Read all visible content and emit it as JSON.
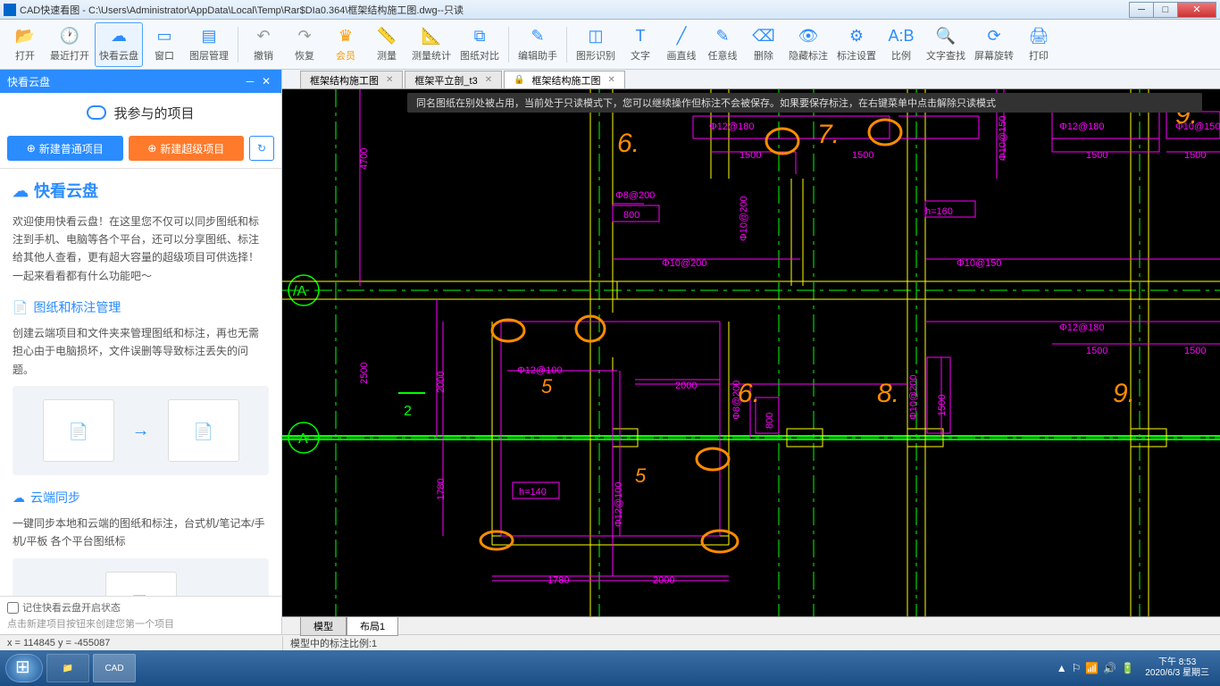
{
  "window": {
    "title": "CAD快速看图 - C:\\Users\\Administrator\\AppData\\Local\\Temp\\Rar$DIa0.364\\框架结构施工图.dwg--只读"
  },
  "toolbar": {
    "open": "打开",
    "recent": "最近打开",
    "cloud": "快看云盘",
    "window": "窗口",
    "layers": "图层管理",
    "undo": "撤销",
    "redo": "恢复",
    "vip": "会员",
    "measure": "测量",
    "measure_stat": "测量统计",
    "compare": "图纸对比",
    "edit_helper": "编辑助手",
    "shape_rec": "图形识别",
    "text": "文字",
    "line": "画直线",
    "freeline": "任意线",
    "delete": "删除",
    "hide_annot": "隐藏标注",
    "annot_set": "标注设置",
    "ratio": "比例",
    "text_search": "文字查找",
    "screen_rotate": "屏幕旋转",
    "print": "打印"
  },
  "sidebar": {
    "header": "快看云盘",
    "title": "我参与的项目",
    "new_normal": "新建普通项目",
    "new_super": "新建超级项目",
    "content_title": "快看云盘",
    "intro": "欢迎使用快看云盘！在这里您不仅可以同步图纸和标注到手机、电脑等各个平台，还可以分享图纸、标注给其他人查看，更有超大容量的超级项目可供选择！一起来看看都有什么功能吧～",
    "sec1_title": "图纸和标注管理",
    "sec1_body": "创建云端项目和文件夹来管理图纸和标注，再也无需担心由于电脑损坏，文件误删等导致标注丢失的问题。",
    "sec2_title": "云端同步",
    "sec2_body": "一键同步本地和云端的图纸和标注，台式机/笔记本/手机/平板 各个平台图纸标",
    "remember": "记住快看云盘开启状态",
    "hint": "点击新建项目按钮来创建您第一个项目"
  },
  "tabs": [
    {
      "label": "框架结构施工图",
      "active": false,
      "locked": false
    },
    {
      "label": "框架平立剖_t3",
      "active": false,
      "locked": false
    },
    {
      "label": "框架结构施工图",
      "active": true,
      "locked": true
    }
  ],
  "notice": "同名图纸在别处被占用，当前处于只读模式下，您可以继续操作但标注不会被保存。如果要保存标注，在右键菜单中点击解除只读模式",
  "layout_tabs": {
    "model": "模型",
    "layout1": "布局1"
  },
  "status": {
    "coords": "x = 114845  y = -455087",
    "scale": "模型中的标注比例:1"
  },
  "taskbar": {
    "time": "下午 8:53",
    "date": "2020/6/3 星期三"
  },
  "drawing": {
    "axis_labels": [
      "/A",
      "A"
    ],
    "dims": {
      "d4700": "4700",
      "d1500": "1500",
      "d800": "800",
      "d2500": "2500",
      "d2000": "2000",
      "d1780": "1780",
      "d_n2": "2",
      "p12_180": "Φ12@180",
      "p8_200": "Φ8@200",
      "p10_200": "Φ10@200",
      "p10_150": "Φ10@150",
      "p12_100": "Φ12@100",
      "p8_200b": "Φ8@200",
      "h140": "h=140",
      "h160": "h=160"
    },
    "marks": {
      "m6": "6.",
      "m7": "7.",
      "m8": "8.",
      "m9": "9.",
      "m5": "5"
    }
  }
}
